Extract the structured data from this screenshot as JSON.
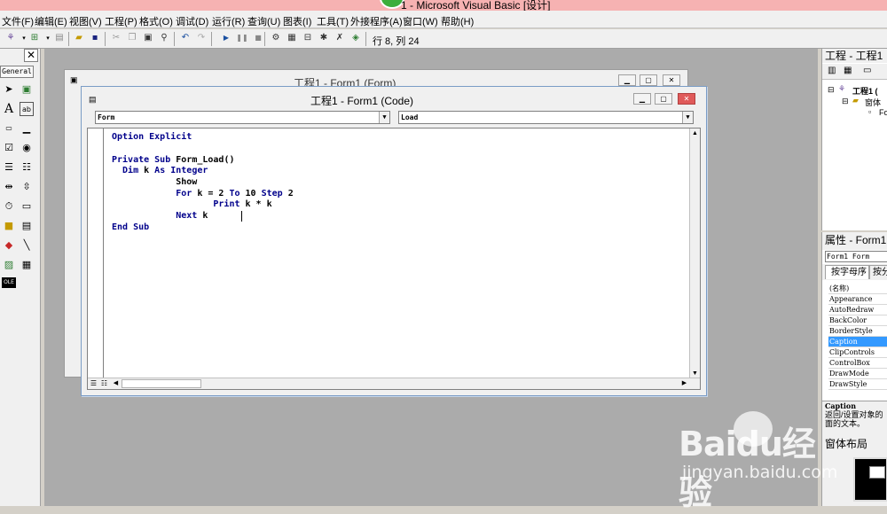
{
  "window": {
    "title": "1 - Microsoft Visual Basic [设计]"
  },
  "menu": [
    "文件(F)",
    "编辑(E)",
    "视图(V)",
    "工程(P)",
    "格式(O)",
    "调试(D)",
    "运行(R)",
    "查询(U)",
    "图表(I)",
    "工具(T)",
    "外接程序(A)",
    "窗口(W)",
    "帮助(H)"
  ],
  "toolbar": {
    "position": "行 8, 列 24"
  },
  "toolbox": {
    "close": "✕",
    "tab": "General",
    "ole_label": "OLE"
  },
  "form_window": {
    "title": "工程1 - Form1 (Form)"
  },
  "code_window": {
    "title": "工程1 - Form1 (Code)",
    "object_combo": "Form",
    "procedure_combo": "Load",
    "lines": [
      [
        {
          "t": "Option Explicit",
          "k": true
        }
      ],
      [],
      [
        {
          "t": "Private Sub",
          "k": true
        },
        {
          "t": " Form_Load()",
          "k": false
        }
      ],
      [
        {
          "t": "  Dim",
          "k": true
        },
        {
          "t": " k ",
          "k": false
        },
        {
          "t": "As Integer",
          "k": true
        }
      ],
      [
        {
          "t": "            Show",
          "k": false
        }
      ],
      [
        {
          "t": "            For",
          "k": true
        },
        {
          "t": " k = 2 ",
          "k": false
        },
        {
          "t": "To",
          "k": true
        },
        {
          "t": " 10 ",
          "k": false
        },
        {
          "t": "Step",
          "k": true
        },
        {
          "t": " 2",
          "k": false
        }
      ],
      [
        {
          "t": "                   Print",
          "k": true
        },
        {
          "t": " k * k",
          "k": false
        }
      ],
      [
        {
          "t": "            Next",
          "k": true
        },
        {
          "t": " k",
          "k": false
        }
      ],
      [
        {
          "t": "End Sub",
          "k": true
        }
      ]
    ]
  },
  "project_panel": {
    "title": "工程 - 工程1",
    "tree": [
      "工程1 (",
      "窗体",
      "Fo"
    ]
  },
  "properties_panel": {
    "title": "属性 - Form1",
    "object": "Form1 Form",
    "tabs": [
      "按字母序",
      "按分"
    ],
    "rows": [
      {
        "name": "(名称)",
        "selected": false
      },
      {
        "name": "Appearance",
        "selected": false
      },
      {
        "name": "AutoRedraw",
        "selected": false
      },
      {
        "name": "BackColor",
        "selected": false
      },
      {
        "name": "BorderStyle",
        "selected": false
      },
      {
        "name": "Caption",
        "selected": true
      },
      {
        "name": "ClipControls",
        "selected": false
      },
      {
        "name": "ControlBox",
        "selected": false
      },
      {
        "name": "DrawMode",
        "selected": false
      },
      {
        "name": "DrawStyle",
        "selected": false
      }
    ],
    "desc_title": "Caption",
    "desc_text": "返回/设置对象的面的文本。"
  },
  "layout_panel": {
    "title": "窗体布局"
  },
  "watermark": {
    "logo": "Baidu经验",
    "url": "jingyan.baidu.com"
  },
  "colors": {
    "keyword": "#00008b",
    "selection": "#3399ff",
    "mdi_background": "#ababab"
  }
}
